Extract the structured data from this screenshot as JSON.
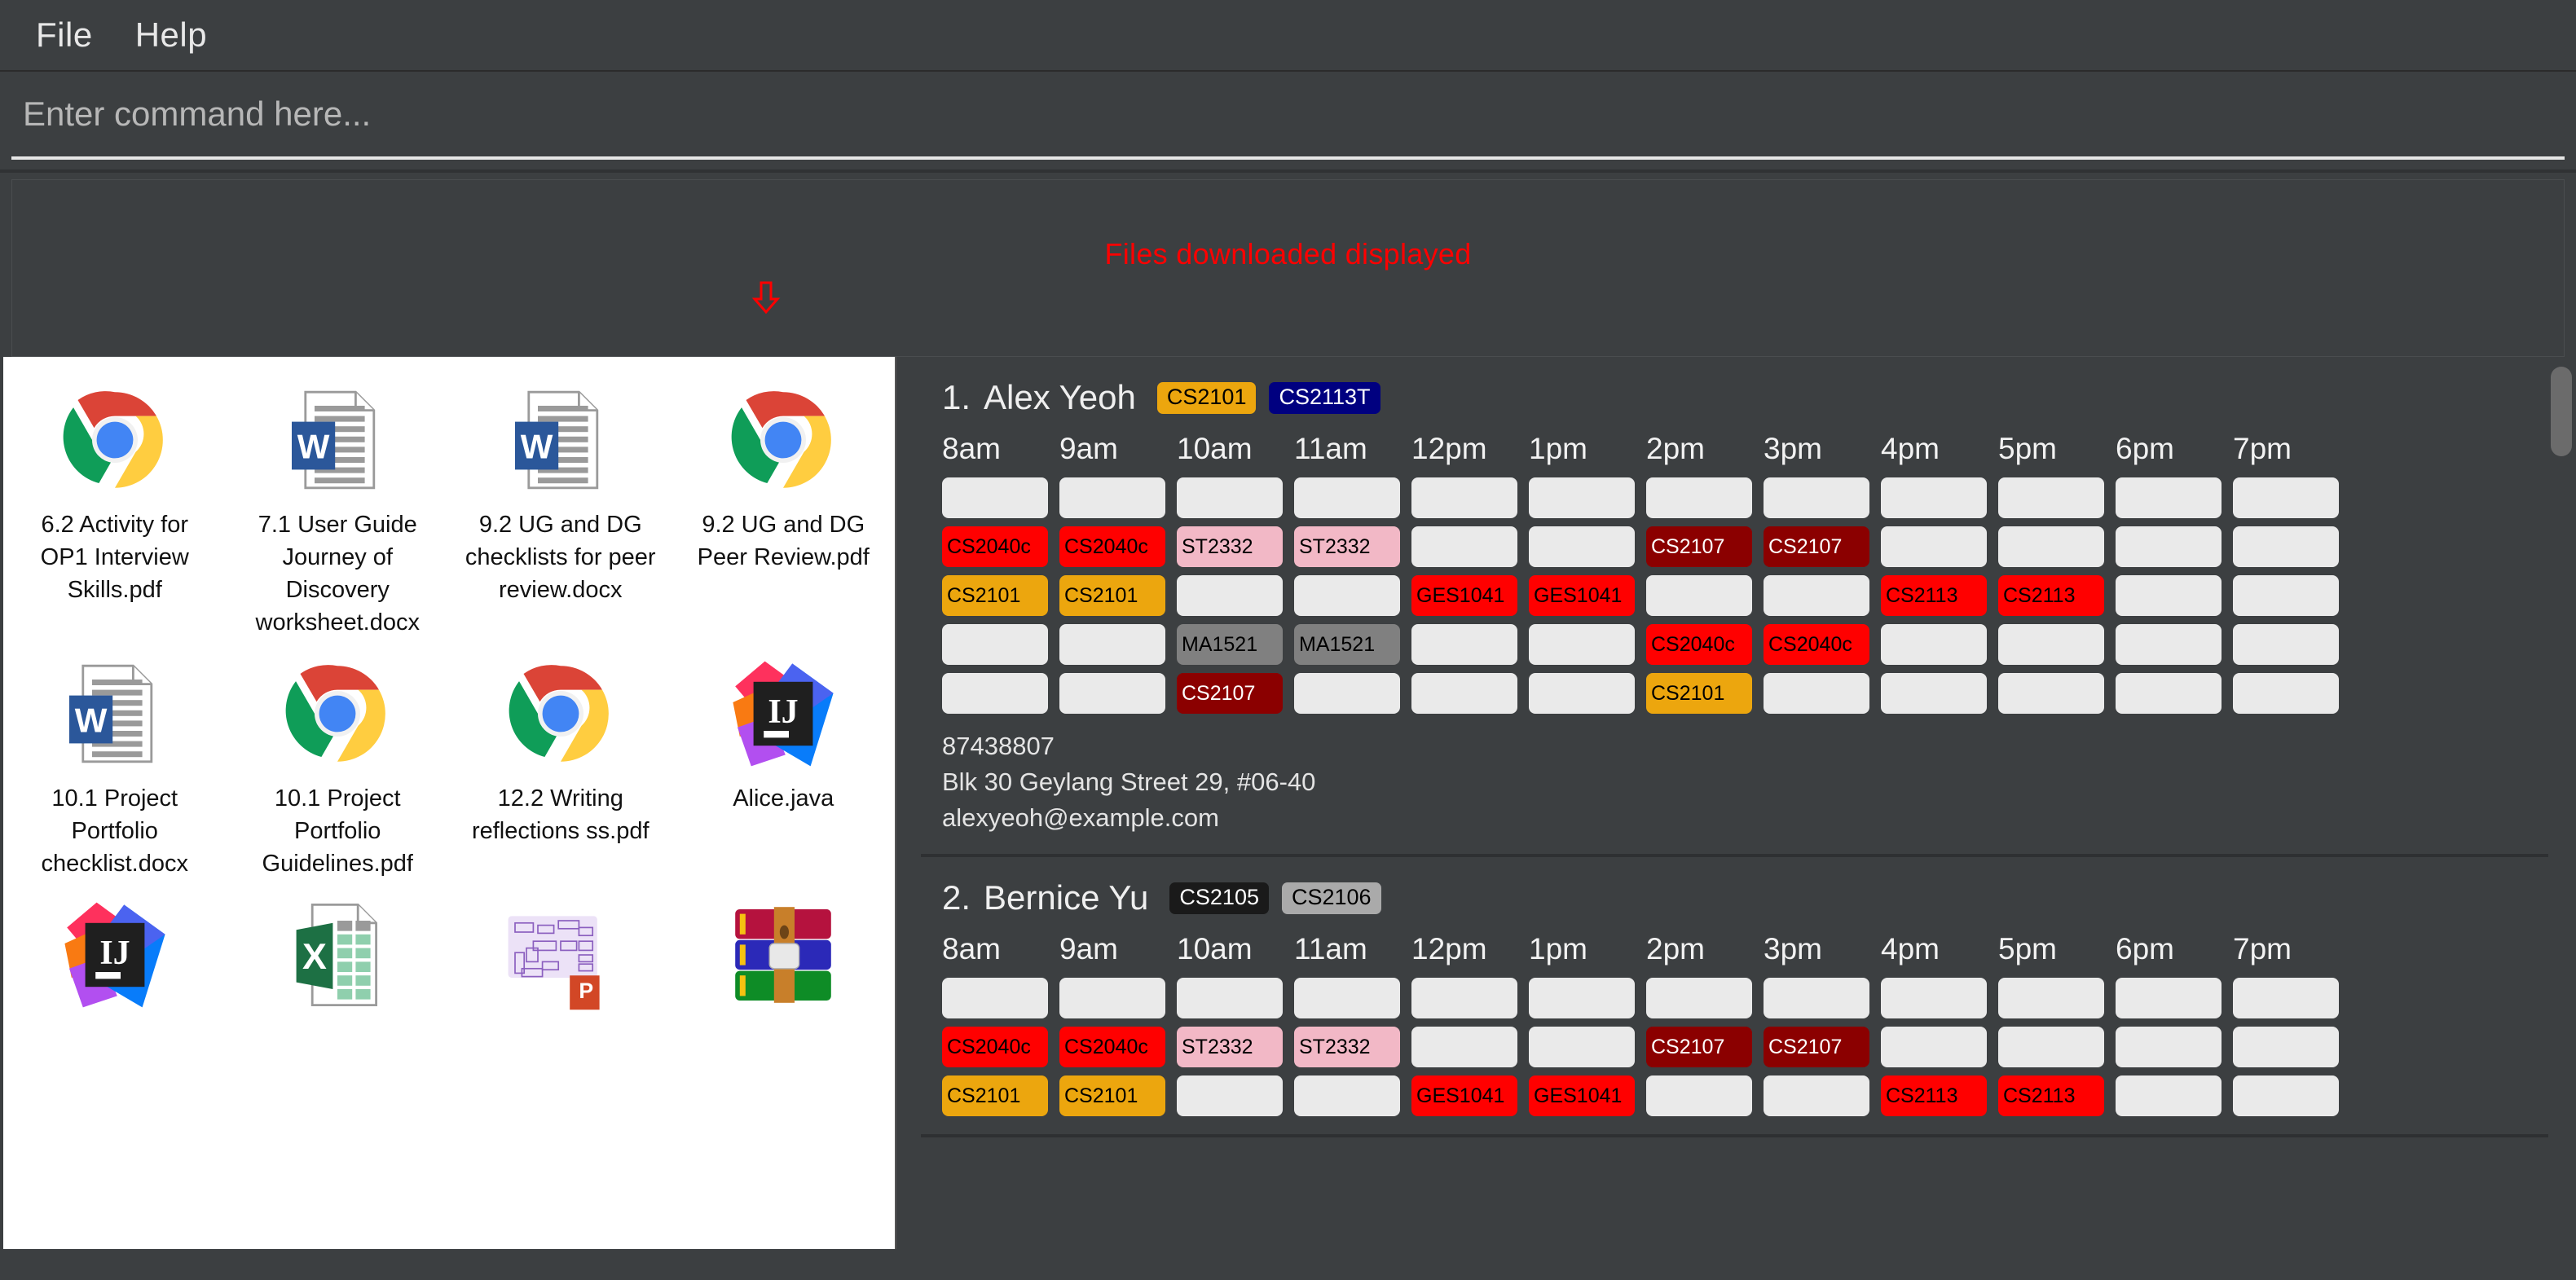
{
  "menu": {
    "items": [
      {
        "label": "File",
        "name": "menu-file"
      },
      {
        "label": "Help",
        "name": "menu-help"
      }
    ]
  },
  "command": {
    "placeholder": "Enter command here...",
    "value": ""
  },
  "annotation": {
    "text": "Files downloaded displayed",
    "color": "#ff0000",
    "arrow": "down-arrow-icon"
  },
  "files": {
    "items": [
      {
        "label": "6.2 Activity for OP1 Interview Skills.pdf",
        "icon": "chrome-icon"
      },
      {
        "label": "7.1 User Guide Journey of Discovery worksheet.docx",
        "icon": "word-doc-icon"
      },
      {
        "label": "9.2 UG and DG checklists for peer review.docx",
        "icon": "word-doc-icon"
      },
      {
        "label": "9.2 UG and DG Peer Review.pdf",
        "icon": "chrome-icon"
      },
      {
        "label": "10.1 Project Portfolio checklist.docx",
        "icon": "word-doc-icon"
      },
      {
        "label": "10.1 Project Portfolio Guidelines.pdf",
        "icon": "chrome-icon"
      },
      {
        "label": "12.2 Writing reflections ss.pdf",
        "icon": "chrome-icon"
      },
      {
        "label": "Alice.java",
        "icon": "intellij-icon"
      },
      {
        "label": "",
        "icon": "intellij-icon"
      },
      {
        "label": "",
        "icon": "excel-icon"
      },
      {
        "label": "",
        "icon": "powerpoint-diagram-icon"
      },
      {
        "label": "",
        "icon": "winrar-archive-icon"
      }
    ]
  },
  "schedule": {
    "hours": [
      "8am",
      "9am",
      "10am",
      "11am",
      "12pm",
      "1pm",
      "2pm",
      "3pm",
      "4pm",
      "5pm",
      "6pm",
      "7pm"
    ],
    "module_colors": {
      "CS2040c": {
        "bg": "#ff0000",
        "fg": "#000000"
      },
      "ST2332": {
        "bg": "#f2b8c6",
        "fg": "#000000"
      },
      "CS2107": {
        "bg": "#8b0000",
        "fg": "#ffffff"
      },
      "CS2101": {
        "bg": "#eca60e",
        "fg": "#000000"
      },
      "GES1041": {
        "bg": "#ff0000",
        "fg": "#000000"
      },
      "CS2113": {
        "bg": "#ff0000",
        "fg": "#000000"
      },
      "MA1521": {
        "bg": "#808080",
        "fg": "#000000"
      },
      "CS2113T": {
        "bg": "#000080",
        "fg": "#ffffff"
      },
      "CS2105": {
        "bg": "#1a1a1a",
        "fg": "#ffffff"
      },
      "CS2106": {
        "bg": "#aaaaaa",
        "fg": "#000000"
      },
      "empty": {
        "bg": "#eaeaea",
        "fg": "#111111"
      }
    },
    "people": [
      {
        "index": "1.",
        "name": "Alex Yeoh",
        "tags": [
          {
            "label": "CS2101",
            "bg": "#eca60e",
            "fg": "#000000"
          },
          {
            "label": "CS2113T",
            "bg": "#000080",
            "fg": "#ffffff"
          }
        ],
        "phone": "87438807",
        "address": "Blk 30 Geylang Street 29, #06-40",
        "email": "alexyeoh@example.com",
        "rows": [
          [
            "",
            "",
            "",
            "",
            "",
            "",
            "",
            "",
            "",
            "",
            "",
            ""
          ],
          [
            "CS2040c",
            "CS2040c",
            "ST2332",
            "ST2332",
            "",
            "",
            "CS2107",
            "CS2107",
            "",
            "",
            "",
            ""
          ],
          [
            "CS2101",
            "CS2101",
            "",
            "",
            "GES1041",
            "GES1041",
            "",
            "",
            "CS2113",
            "CS2113",
            "",
            ""
          ],
          [
            "",
            "",
            "MA1521",
            "MA1521",
            "",
            "",
            "CS2040c",
            "CS2040c",
            "",
            "",
            "",
            ""
          ],
          [
            "",
            "",
            "CS2107",
            "",
            "",
            "",
            "CS2101",
            "",
            "",
            "",
            "",
            ""
          ]
        ]
      },
      {
        "index": "2.",
        "name": "Bernice Yu",
        "tags": [
          {
            "label": "CS2105",
            "bg": "#1a1a1a",
            "fg": "#ffffff"
          },
          {
            "label": "CS2106",
            "bg": "#aaaaaa",
            "fg": "#000000"
          }
        ],
        "phone": "",
        "address": "",
        "email": "",
        "rows": [
          [
            "",
            "",
            "",
            "",
            "",
            "",
            "",
            "",
            "",
            "",
            "",
            ""
          ],
          [
            "CS2040c",
            "CS2040c",
            "ST2332",
            "ST2332",
            "",
            "",
            "CS2107",
            "CS2107",
            "",
            "",
            "",
            ""
          ],
          [
            "CS2101",
            "CS2101",
            "",
            "",
            "GES1041",
            "GES1041",
            "",
            "",
            "CS2113",
            "CS2113",
            "",
            ""
          ]
        ]
      }
    ]
  }
}
